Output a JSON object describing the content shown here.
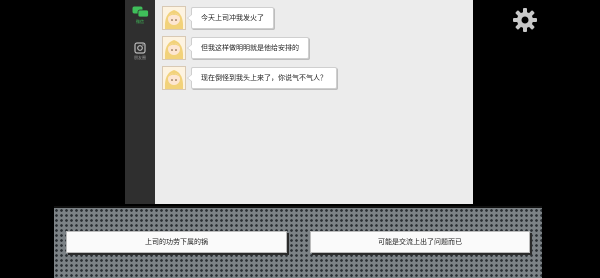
{
  "sidebar": {
    "items": [
      {
        "label": "微信",
        "icon": "chat-bubble-icon",
        "color": "#3fbf5a"
      },
      {
        "label": "朋友圈",
        "icon": "camera-icon"
      }
    ]
  },
  "chat": {
    "messages": [
      {
        "sender_avatar": "blonde-girl-avatar",
        "text": "今天上司冲我发火了"
      },
      {
        "sender_avatar": "blonde-girl-avatar",
        "text": "但我这样做明明就是他给安排的"
      },
      {
        "sender_avatar": "blonde-girl-avatar",
        "text": "现在倒怪到我头上来了，你说气不气人？"
      }
    ]
  },
  "settings": {
    "icon": "gear-icon"
  },
  "choices": [
    {
      "label": "上司的功劳下属的锅"
    },
    {
      "label": "可能是交流上出了问题而已"
    }
  ]
}
